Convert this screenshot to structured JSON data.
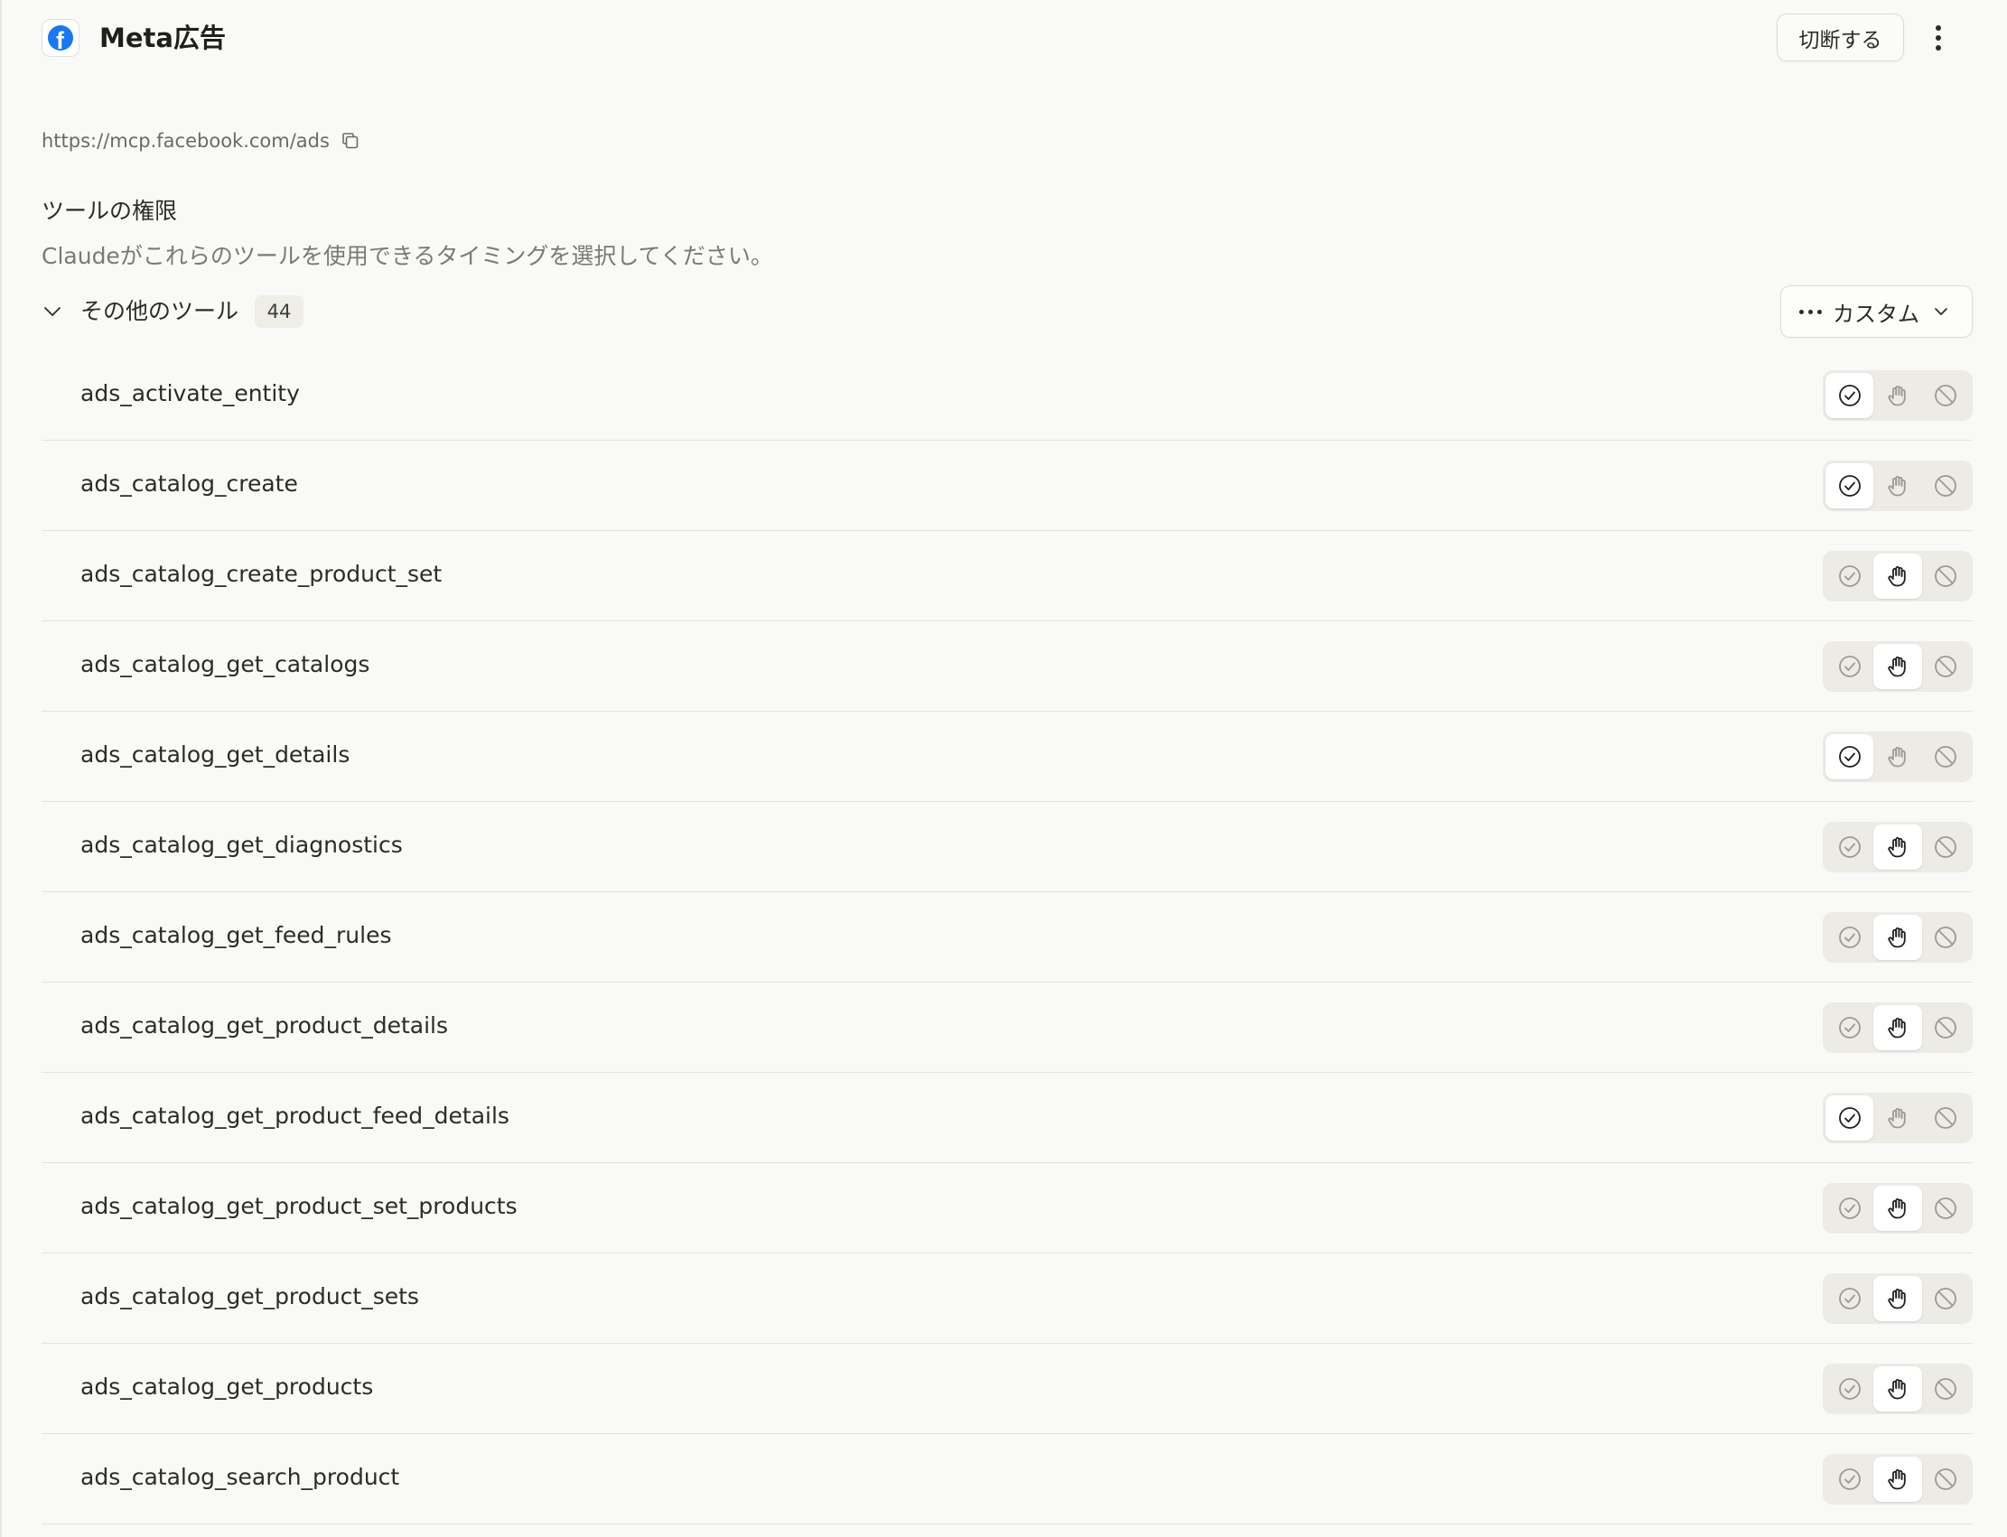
{
  "header": {
    "title": "Meta広告",
    "disconnect_label": "切断する",
    "logo_icon": "facebook-logo-icon",
    "more_icon": "more-vertical-icon"
  },
  "server": {
    "url": "https://mcp.facebook.com/ads",
    "copy_icon": "copy-icon"
  },
  "permissions": {
    "title": "ツールの権限",
    "description": "Claudeがこれらのツールを使用できるタイミングを選択してください。"
  },
  "group": {
    "label": "その他のツール",
    "count": "44",
    "mode_label": "カスタム",
    "mode_icon": "more-horizontal-icon"
  },
  "permission_options": [
    "always-allow-check-icon",
    "ask-hand-icon",
    "block-icon"
  ],
  "tools": [
    {
      "name": "ads_activate_entity",
      "permission": "allow"
    },
    {
      "name": "ads_catalog_create",
      "permission": "allow"
    },
    {
      "name": "ads_catalog_create_product_set",
      "permission": "ask"
    },
    {
      "name": "ads_catalog_get_catalogs",
      "permission": "ask"
    },
    {
      "name": "ads_catalog_get_details",
      "permission": "allow"
    },
    {
      "name": "ads_catalog_get_diagnostics",
      "permission": "ask"
    },
    {
      "name": "ads_catalog_get_feed_rules",
      "permission": "ask"
    },
    {
      "name": "ads_catalog_get_product_details",
      "permission": "ask"
    },
    {
      "name": "ads_catalog_get_product_feed_details",
      "permission": "allow"
    },
    {
      "name": "ads_catalog_get_product_set_products",
      "permission": "ask"
    },
    {
      "name": "ads_catalog_get_product_sets",
      "permission": "ask"
    },
    {
      "name": "ads_catalog_get_products",
      "permission": "ask"
    },
    {
      "name": "ads_catalog_search_product",
      "permission": "ask"
    }
  ],
  "colors": {
    "background": "#f9f9f7",
    "facebook_blue": "#1877f2",
    "active_icon": "#1f1f1c",
    "inactive_icon": "#9a9993"
  }
}
